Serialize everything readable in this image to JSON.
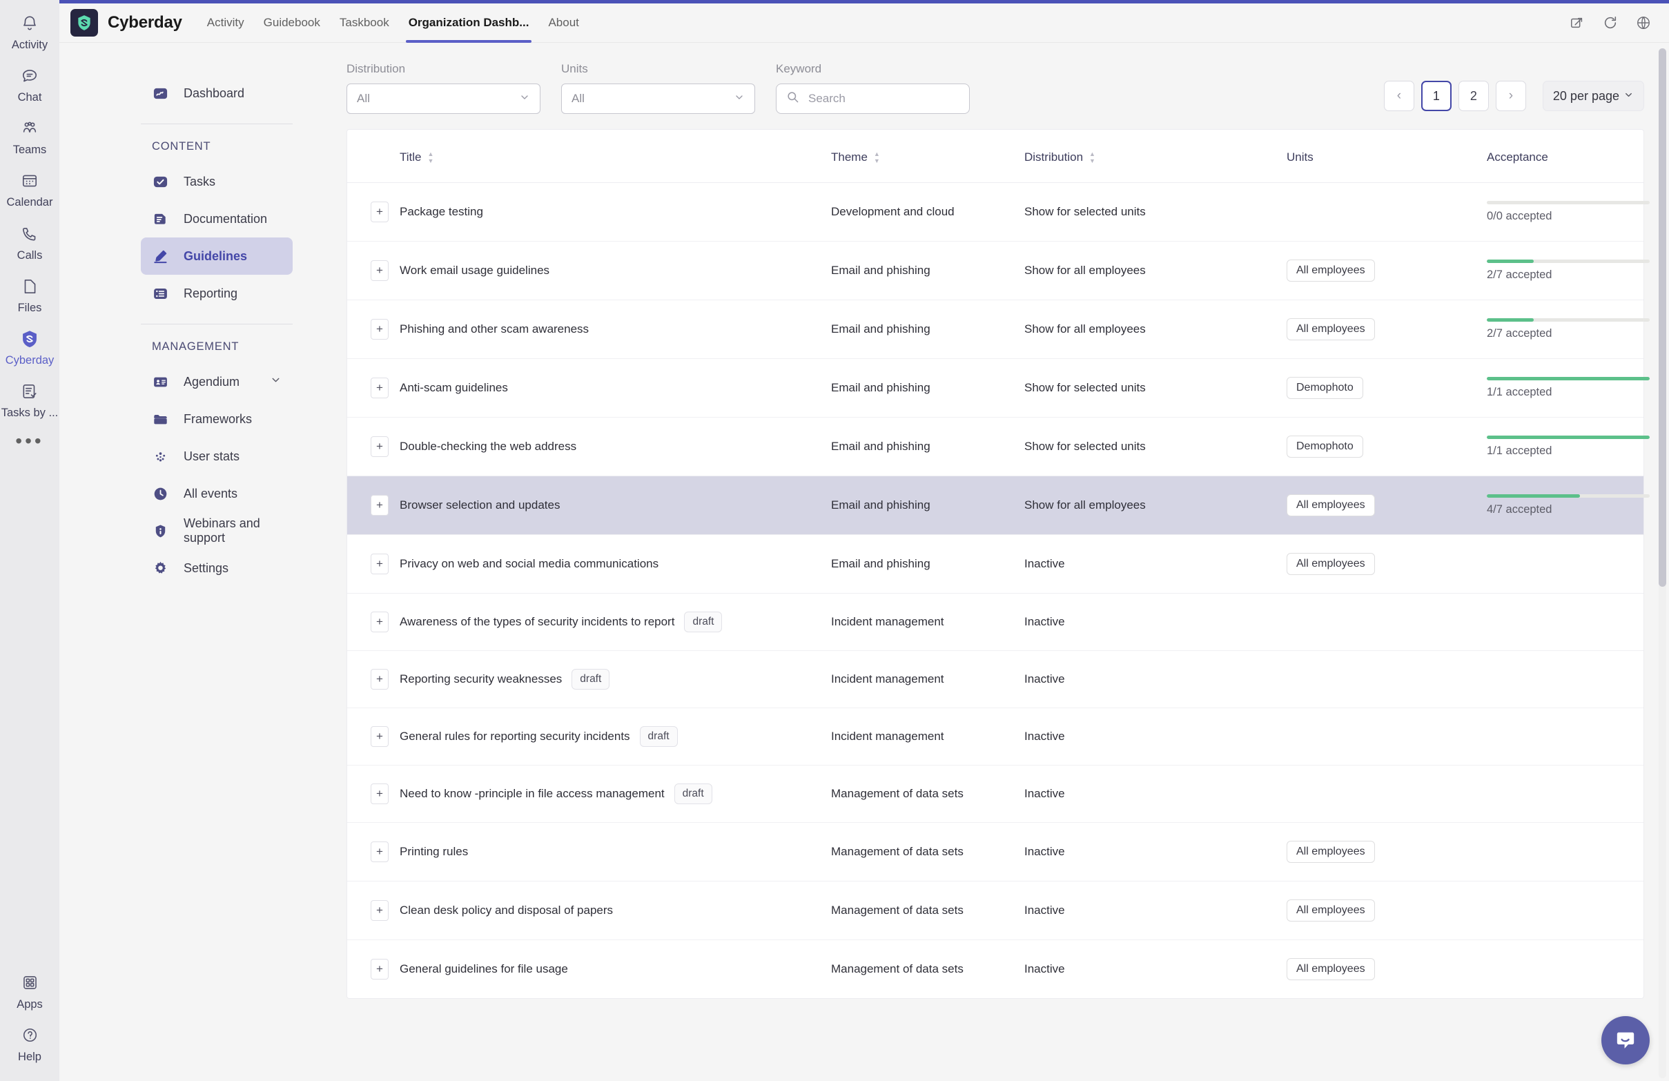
{
  "rail": {
    "items": [
      {
        "label": "Activity",
        "icon": "bell-icon",
        "active": false
      },
      {
        "label": "Chat",
        "icon": "chat-icon",
        "active": false
      },
      {
        "label": "Teams",
        "icon": "teams-icon",
        "active": false
      },
      {
        "label": "Calendar",
        "icon": "calendar-icon",
        "active": false
      },
      {
        "label": "Calls",
        "icon": "phone-icon",
        "active": false
      },
      {
        "label": "Files",
        "icon": "file-icon",
        "active": false
      },
      {
        "label": "Cyberday",
        "icon": "cyberday-shield-icon",
        "active": true
      },
      {
        "label": "Tasks by ...",
        "icon": "tasks-icon",
        "active": false
      }
    ],
    "more": "•••",
    "bottom": [
      {
        "label": "Apps",
        "icon": "apps-grid-icon"
      },
      {
        "label": "Help",
        "icon": "question-circle-icon"
      }
    ]
  },
  "topbar": {
    "app_name": "Cyberday",
    "logo_icon": "cyberday-logo-icon",
    "tabs": [
      {
        "label": "Activity",
        "active": false
      },
      {
        "label": "Guidebook",
        "active": false
      },
      {
        "label": "Taskbook",
        "active": false
      },
      {
        "label": "Organization Dashb...",
        "active": true
      },
      {
        "label": "About",
        "active": false
      }
    ],
    "actions": [
      {
        "icon": "popout-icon",
        "name": "open-in-new-window-button"
      },
      {
        "icon": "refresh-icon",
        "name": "refresh-button"
      },
      {
        "icon": "globe-icon",
        "name": "language-button"
      }
    ]
  },
  "leftnav": {
    "dashboard": {
      "label": "Dashboard",
      "icon": "dashboard-icon"
    },
    "sections": [
      {
        "title": "CONTENT",
        "items": [
          {
            "label": "Tasks",
            "icon": "check-square-icon",
            "active": false,
            "chevron": false
          },
          {
            "label": "Documentation",
            "icon": "document-icon",
            "active": false,
            "chevron": false
          },
          {
            "label": "Guidelines",
            "icon": "pencil-icon",
            "active": true,
            "chevron": false
          },
          {
            "label": "Reporting",
            "icon": "report-icon",
            "active": false,
            "chevron": false
          }
        ]
      },
      {
        "title": "MANAGEMENT",
        "items": [
          {
            "label": "Agendium",
            "icon": "id-card-icon",
            "active": false,
            "chevron": true
          },
          {
            "label": "Frameworks",
            "icon": "folder-icon",
            "active": false,
            "chevron": false
          },
          {
            "label": "User stats",
            "icon": "user-stats-icon",
            "active": false,
            "chevron": false
          },
          {
            "label": "All events",
            "icon": "clock-icon",
            "active": false,
            "chevron": false
          },
          {
            "label": "Webinars and support",
            "icon": "info-shield-icon",
            "active": false,
            "chevron": false
          },
          {
            "label": "Settings",
            "icon": "gear-icon",
            "active": false,
            "chevron": false
          }
        ]
      }
    ]
  },
  "toolbar": {
    "distribution": {
      "label": "Distribution",
      "value": "All"
    },
    "units": {
      "label": "Units",
      "value": "All"
    },
    "keyword": {
      "label": "Keyword",
      "value": "",
      "placeholder": "Search",
      "icon": "search-icon"
    },
    "pagination": {
      "prev": "‹",
      "next": "›",
      "pages": [
        "1",
        "2"
      ],
      "current": "1",
      "per_page": "20 per page"
    }
  },
  "table": {
    "columns": [
      {
        "key": "expand",
        "label": "",
        "sortable": false
      },
      {
        "key": "title",
        "label": "Title",
        "sortable": true
      },
      {
        "key": "theme",
        "label": "Theme",
        "sortable": true
      },
      {
        "key": "distribution",
        "label": "Distribution",
        "sortable": true
      },
      {
        "key": "units",
        "label": "Units",
        "sortable": false
      },
      {
        "key": "acceptance",
        "label": "Acceptance",
        "sortable": false
      }
    ],
    "rows": [
      {
        "title": "Package testing",
        "draft": false,
        "theme": "Development and cloud",
        "distribution": "Show for selected units",
        "units": "",
        "acceptance": {
          "label": "0/0 accepted",
          "accepted": 0,
          "total": 0,
          "percent": 0,
          "show_bar": true
        },
        "highlighted": false
      },
      {
        "title": "Work email usage guidelines",
        "draft": false,
        "theme": "Email and phishing",
        "distribution": "Show for all employees",
        "units": "All employees",
        "acceptance": {
          "label": "2/7 accepted",
          "accepted": 2,
          "total": 7,
          "percent": 29,
          "show_bar": true
        },
        "highlighted": false
      },
      {
        "title": "Phishing and other scam awareness",
        "draft": false,
        "theme": "Email and phishing",
        "distribution": "Show for all employees",
        "units": "All employees",
        "acceptance": {
          "label": "2/7 accepted",
          "accepted": 2,
          "total": 7,
          "percent": 29,
          "show_bar": true
        },
        "highlighted": false
      },
      {
        "title": "Anti-scam guidelines",
        "draft": false,
        "theme": "Email and phishing",
        "distribution": "Show for selected units",
        "units": "Demophoto",
        "acceptance": {
          "label": "1/1 accepted",
          "accepted": 1,
          "total": 1,
          "percent": 100,
          "show_bar": true
        },
        "highlighted": false
      },
      {
        "title": "Double-checking the web address",
        "draft": false,
        "theme": "Email and phishing",
        "distribution": "Show for selected units",
        "units": "Demophoto",
        "acceptance": {
          "label": "1/1 accepted",
          "accepted": 1,
          "total": 1,
          "percent": 100,
          "show_bar": true
        },
        "highlighted": false
      },
      {
        "title": "Browser selection and updates",
        "draft": false,
        "theme": "Email and phishing",
        "distribution": "Show for all employees",
        "units": "All employees",
        "acceptance": {
          "label": "4/7 accepted",
          "accepted": 4,
          "total": 7,
          "percent": 57,
          "show_bar": true
        },
        "highlighted": true
      },
      {
        "title": "Privacy on web and social media communications",
        "draft": false,
        "theme": "Email and phishing",
        "distribution": "Inactive",
        "units": "All employees",
        "acceptance": {
          "label": "",
          "accepted": 0,
          "total": 0,
          "percent": 0,
          "show_bar": false
        },
        "highlighted": false
      },
      {
        "title": "Awareness of the types of security incidents to report",
        "draft": true,
        "draft_label": "draft",
        "theme": "Incident management",
        "distribution": "Inactive",
        "units": "",
        "acceptance": {
          "label": "",
          "accepted": 0,
          "total": 0,
          "percent": 0,
          "show_bar": false
        },
        "highlighted": false
      },
      {
        "title": "Reporting security weaknesses",
        "draft": true,
        "draft_label": "draft",
        "theme": "Incident management",
        "distribution": "Inactive",
        "units": "",
        "acceptance": {
          "label": "",
          "accepted": 0,
          "total": 0,
          "percent": 0,
          "show_bar": false
        },
        "highlighted": false
      },
      {
        "title": "General rules for reporting security incidents",
        "draft": true,
        "draft_label": "draft",
        "theme": "Incident management",
        "distribution": "Inactive",
        "units": "",
        "acceptance": {
          "label": "",
          "accepted": 0,
          "total": 0,
          "percent": 0,
          "show_bar": false
        },
        "highlighted": false
      },
      {
        "title": "Need to know -principle in file access management",
        "draft": true,
        "draft_label": "draft",
        "theme": "Management of data sets",
        "distribution": "Inactive",
        "units": "",
        "acceptance": {
          "label": "",
          "accepted": 0,
          "total": 0,
          "percent": 0,
          "show_bar": false
        },
        "highlighted": false
      },
      {
        "title": "Printing rules",
        "draft": false,
        "theme": "Management of data sets",
        "distribution": "Inactive",
        "units": "All employees",
        "acceptance": {
          "label": "",
          "accepted": 0,
          "total": 0,
          "percent": 0,
          "show_bar": false
        },
        "highlighted": false
      },
      {
        "title": "Clean desk policy and disposal of papers",
        "draft": false,
        "theme": "Management of data sets",
        "distribution": "Inactive",
        "units": "All employees",
        "acceptance": {
          "label": "",
          "accepted": 0,
          "total": 0,
          "percent": 0,
          "show_bar": false
        },
        "highlighted": false
      },
      {
        "title": "General guidelines for file usage",
        "draft": false,
        "theme": "Management of data sets",
        "distribution": "Inactive",
        "units": "All employees",
        "acceptance": {
          "label": "",
          "accepted": 0,
          "total": 0,
          "percent": 0,
          "show_bar": false
        },
        "highlighted": false
      }
    ],
    "expand_symbol": "+"
  },
  "fab": {
    "icon": "chat-bubble-icon"
  },
  "colors": {
    "accent": "#5b5fc7",
    "accent_dark": "#4447a8",
    "progress_green": "#5cc08a",
    "row_highlight": "#d5d5e4",
    "topbar_bg": "#f5f5f5",
    "rail_bg": "#eaeaec"
  }
}
